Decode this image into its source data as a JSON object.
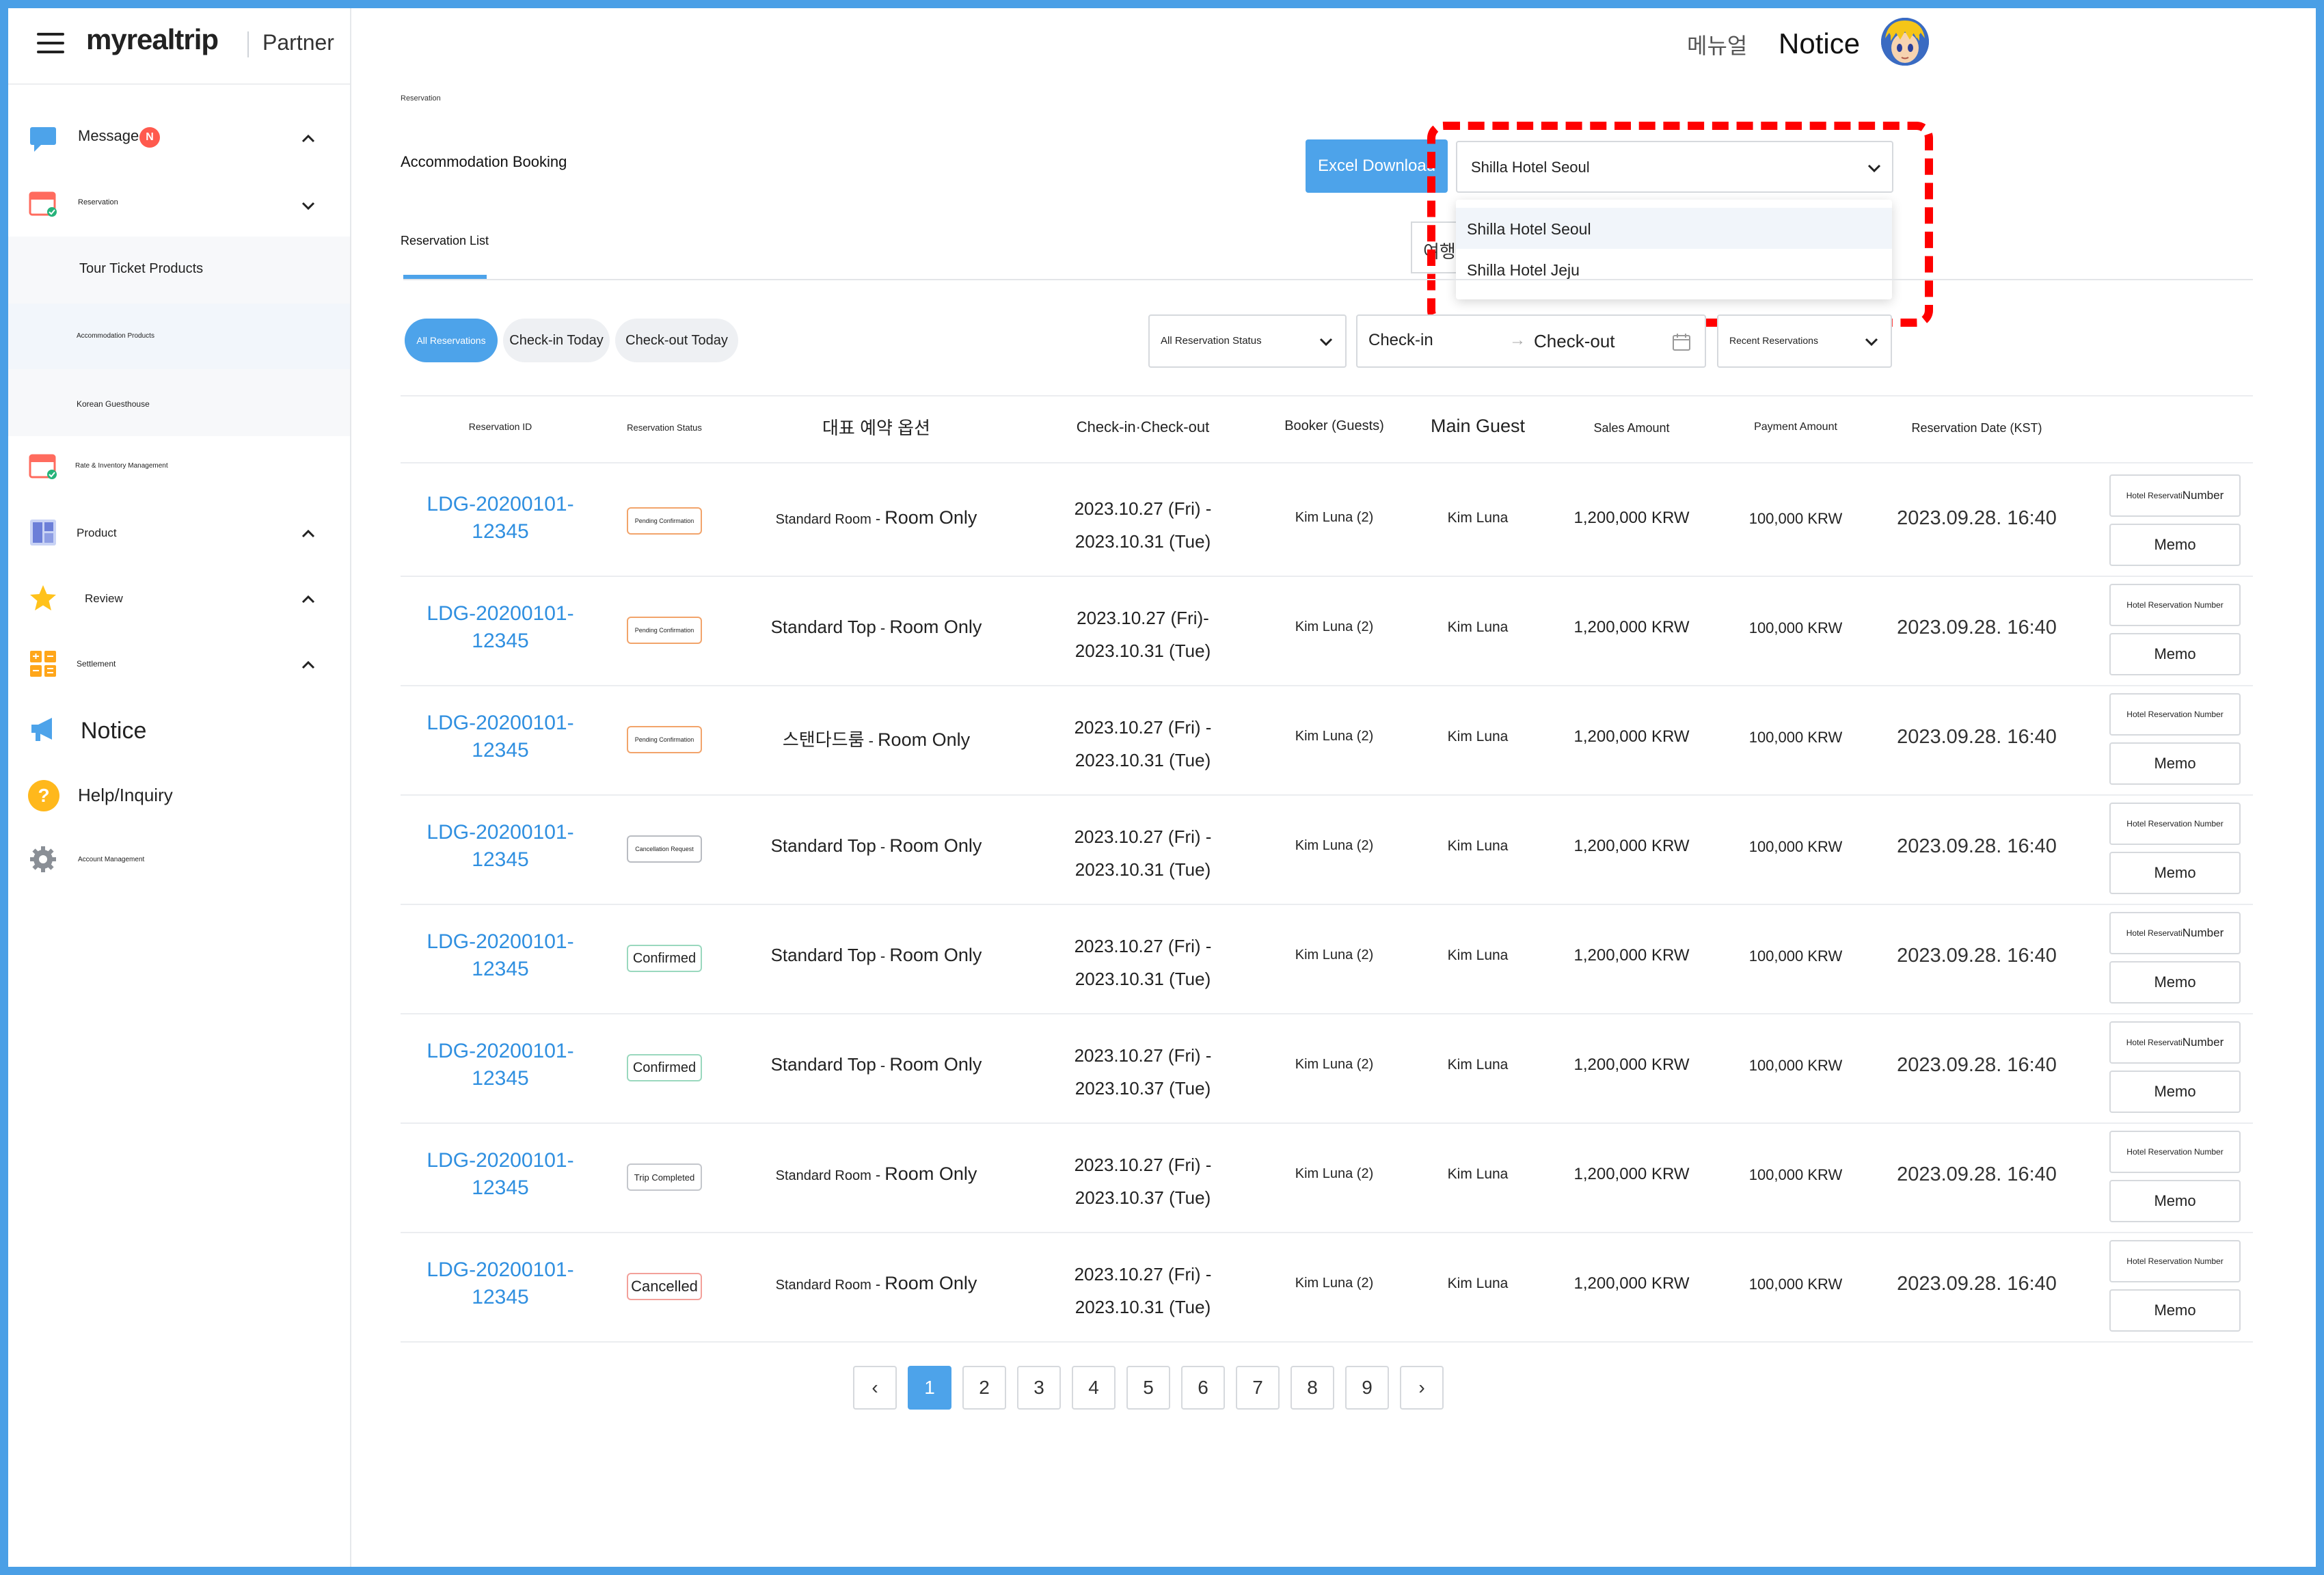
{
  "app": {
    "logo_text": "myrealtrip",
    "partner_label": "Partner"
  },
  "header": {
    "manual_label": "메뉴얼",
    "notice_label": "Notice"
  },
  "sidebar": {
    "message_label": "Message",
    "message_badge": "N",
    "reservation_label": "Reservation",
    "sub_tour": "Tour Ticket Products",
    "sub_accommodation": "Accommodation Products",
    "sub_guesthouse": "Korean Guesthouse",
    "rate_label": "Rate & Inventory Management",
    "product_label": "Product",
    "review_label": "Review",
    "settlement_label": "Settlement",
    "notice_label": "Notice",
    "help_label": "Help/Inquiry",
    "account_label": "Account Management"
  },
  "content": {
    "breadcrumb": "Reservation",
    "page_title": "Accommodation Booking",
    "excel_button": "Excel Download",
    "hotel_selected": "Shilla Hotel Seoul",
    "hotel_options": [
      "Shilla Hotel Seoul",
      "Shilla Hotel Jeju"
    ],
    "hidden_search_text": "여행",
    "tab_label": "Reservation List"
  },
  "filters": {
    "pill_all": "All Reservations",
    "pill_checkin": "Check-in Today",
    "pill_checkout": "Check-out Today",
    "status_select": "All Reservation Status",
    "checkin_label": "Check-in",
    "arrow": "→",
    "checkout_label": "Check-out",
    "sort_select": "Recent Reservations"
  },
  "table": {
    "headers": {
      "id": "Reservation ID",
      "status": "Reservation Status",
      "option": "대표 예약 옵션",
      "dates": "Check-in·Check-out",
      "booker": "Booker (Guests)",
      "guest": "Main Guest",
      "sales": "Sales Amount",
      "payment": "Payment Amount",
      "date": "Reservation Date (KST)"
    },
    "rows": [
      {
        "id1": "LDG-20200101-",
        "id2": "12345",
        "status": "Pending Confirmation",
        "room": "Standard Room",
        "sep": " - ",
        "plan": "Room Only",
        "in": "2023.10.27 (Fri) -",
        "out": "2023.10.31 (Tue)",
        "booker": "Kim Luna (2)",
        "guest": "Kim Luna",
        "sales": "1,200,000 KRW",
        "payment": "100,000 KRW",
        "date": "2023.09.28. 16:40",
        "btn1a": "Hotel Reservati",
        "btn1b": "Number",
        "btn2": "Memo"
      },
      {
        "id1": "LDG-20200101-",
        "id2": "12345",
        "status": "Pending Confirmation",
        "room": "Standard Top",
        "sep": " - ",
        "plan": "Room Only",
        "in": "2023.10.27 (Fri)-",
        "out": "2023.10.31 (Tue)",
        "booker": "Kim Luna (2)",
        "guest": "Kim Luna",
        "sales": "1,200,000 KRW",
        "payment": "100,000 KRW",
        "date": "2023.09.28. 16:40",
        "btn1a": "Hotel Reservation Number",
        "btn1b": "",
        "btn2": "Memo"
      },
      {
        "id1": "LDG-20200101-",
        "id2": "12345",
        "status": "Pending Confirmation",
        "room": "스탠다드룸",
        "sep": " - ",
        "plan": "Room Only",
        "in": "2023.10.27 (Fri) -",
        "out": "2023.10.31 (Tue)",
        "booker": "Kim Luna (2)",
        "guest": "Kim Luna",
        "sales": "1,200,000 KRW",
        "payment": "100,000 KRW",
        "date": "2023.09.28. 16:40",
        "btn1a": "Hotel Reservation Number",
        "btn1b": "",
        "btn2": "Memo"
      },
      {
        "id1": "LDG-20200101-",
        "id2": "12345",
        "status": "Cancellation Request",
        "room": "Standard Top",
        "sep": " - ",
        "plan": "Room Only",
        "in": "2023.10.27 (Fri) -",
        "out": "2023.10.31 (Tue)",
        "booker": "Kim Luna (2)",
        "guest": "Kim Luna",
        "sales": "1,200,000 KRW",
        "payment": "100,000 KRW",
        "date": "2023.09.28. 16:40",
        "btn1a": "Hotel Reservation Number",
        "btn1b": "",
        "btn2": "Memo"
      },
      {
        "id1": "LDG-20200101-",
        "id2": "12345",
        "status": "Confirmed",
        "room": "Standard Top",
        "sep": " - ",
        "plan": "Room Only",
        "in": "2023.10.27 (Fri) -",
        "out": "2023.10.31 (Tue)",
        "booker": "Kim Luna (2)",
        "guest": "Kim Luna",
        "sales": "1,200,000 KRW",
        "payment": "100,000 KRW",
        "date": "2023.09.28. 16:40",
        "btn1a": "Hotel Reservati",
        "btn1b": "Number",
        "btn2": "Memo"
      },
      {
        "id1": "LDG-20200101-",
        "id2": "12345",
        "status": "Confirmed",
        "room": "Standard Top",
        "sep": " - ",
        "plan": "Room Only",
        "in": "2023.10.27 (Fri) -",
        "out": "2023.10.37 (Tue)",
        "booker": "Kim Luna (2)",
        "guest": "Kim Luna",
        "sales": "1,200,000 KRW",
        "payment": "100,000 KRW",
        "date": "2023.09.28. 16:40",
        "btn1a": "Hotel Reservati",
        "btn1b": "Number",
        "btn2": "Memo"
      },
      {
        "id1": "LDG-20200101-",
        "id2": "12345",
        "status": "Trip Completed",
        "room": "Standard Room",
        "sep": " - ",
        "plan": "Room Only",
        "in": "2023.10.27 (Fri) -",
        "out": "2023.10.37 (Tue)",
        "booker": "Kim Luna (2)",
        "guest": "Kim Luna",
        "sales": "1,200,000 KRW",
        "payment": "100,000 KRW",
        "date": "2023.09.28. 16:40",
        "btn1a": "Hotel Reservation Number",
        "btn1b": "",
        "btn2": "Memo"
      },
      {
        "id1": "LDG-20200101-",
        "id2": "12345",
        "status": "Cancelled",
        "room": "Standard Room",
        "sep": " - ",
        "plan": "Room Only",
        "in": "2023.10.27 (Fri) -",
        "out": "2023.10.31 (Tue)",
        "booker": "Kim Luna (2)",
        "guest": "Kim Luna",
        "sales": "1,200,000 KRW",
        "payment": "100,000 KRW",
        "date": "2023.09.28. 16:40",
        "btn1a": "Hotel Reservation Number",
        "btn1b": "",
        "btn2": "Memo"
      }
    ]
  },
  "pagination": {
    "pages": [
      "1",
      "2",
      "3",
      "4",
      "5",
      "6",
      "7",
      "8",
      "9"
    ],
    "current": "1",
    "prev": "‹",
    "next": "›"
  },
  "colors": {
    "accent": "#4da3ea",
    "link": "#2f8fe0",
    "badge": "#ff5a4e",
    "highlight": "#ff0000"
  }
}
